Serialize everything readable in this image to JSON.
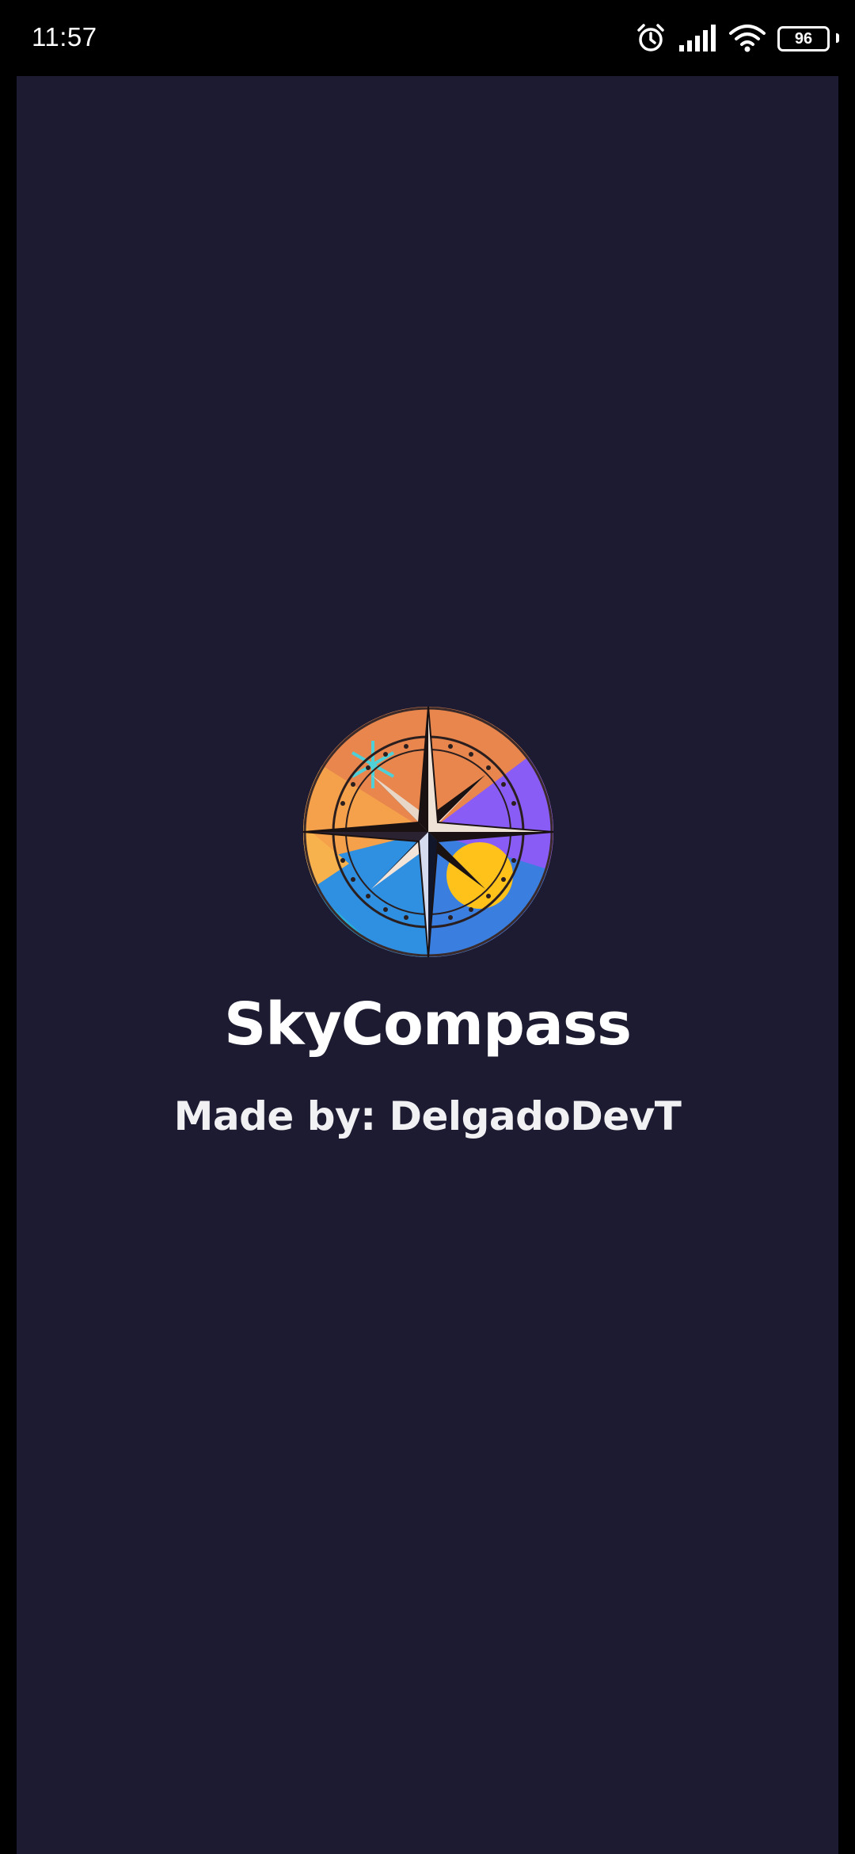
{
  "status_bar": {
    "time": "11:57",
    "battery_level": "96",
    "icons": [
      "alarm-icon",
      "signal-icon",
      "wifi-icon",
      "battery-icon"
    ]
  },
  "splash": {
    "logo_icon": "compass-logo-icon",
    "title": "SkyCompass",
    "author": "Made by: DelgadoDevT"
  },
  "colors": {
    "background": "#1c1b31",
    "status_bar": "#000000",
    "text": "#ffffff",
    "logo_orange": "#e8864e",
    "logo_purple": "#8a5cf6",
    "logo_yellow": "#ffc21a",
    "logo_blue": "#2f8fe0"
  }
}
